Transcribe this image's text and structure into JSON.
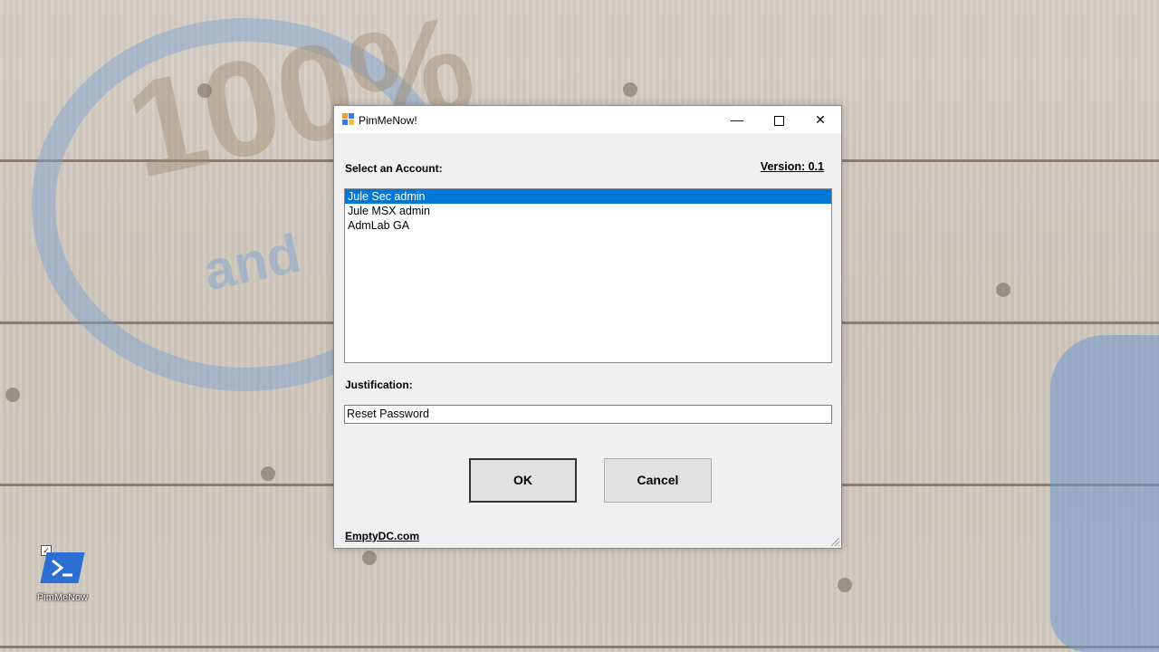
{
  "desktop": {
    "icon_label": "PimMeNow",
    "icon_name": "powershell-icon"
  },
  "window": {
    "title": "PimMeNow!",
    "controls": {
      "minimize": "—",
      "close": "✕"
    },
    "select_label": "Select an Account:",
    "version_label": "Version: 0.1",
    "accounts": [
      {
        "label": "Jule Sec admin",
        "selected": true
      },
      {
        "label": "Jule MSX admin",
        "selected": false
      },
      {
        "label": "AdmLab GA",
        "selected": false
      }
    ],
    "justification_label": "Justification:",
    "justification_value": "Reset Password",
    "ok_label": "OK",
    "cancel_label": "Cancel",
    "footer_link": "EmptyDC.com"
  },
  "colors": {
    "selection": "#0078d7",
    "window_bg": "#f0f0f0"
  }
}
